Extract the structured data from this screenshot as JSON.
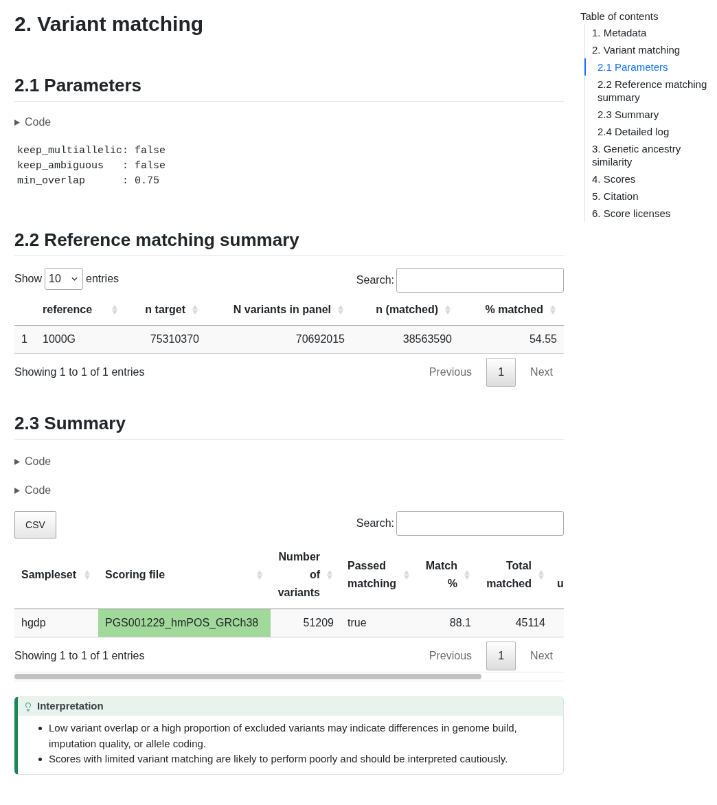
{
  "page": {
    "title": "2. Variant matching"
  },
  "parameters": {
    "heading": "2.1 Parameters",
    "code_toggle": {
      "label": "Code",
      "expanded": false
    },
    "output": [
      "keep_multiallelic: false",
      "keep_ambiguous   : false",
      "min_overlap      : 0.75"
    ]
  },
  "reference_matching": {
    "heading": "2.2 Reference matching summary",
    "length_menu": {
      "before": "Show",
      "value": "10",
      "after": "entries"
    },
    "search": {
      "label": "Search:"
    },
    "table": {
      "columns": [
        {
          "kind": "index",
          "sortable": false
        },
        {
          "label": "reference",
          "kind": "text",
          "sortable": true
        },
        {
          "label": "n target",
          "kind": "numeric",
          "sortable": true
        },
        {
          "label": "N variants in panel",
          "kind": "numeric",
          "sortable": true
        },
        {
          "label": "n (matched)",
          "kind": "numeric",
          "sortable": true
        },
        {
          "label": "% matched",
          "kind": "numeric",
          "sortable": true
        }
      ],
      "rows": [
        {
          "cells": [
            {
              "text": "1"
            },
            {
              "text": "1000G"
            },
            {
              "text": "75310370"
            },
            {
              "text": "70692015"
            },
            {
              "text": "38563590"
            },
            {
              "text": "54.55"
            }
          ]
        }
      ]
    },
    "info": "Showing 1 to 1 of 1 entries",
    "pagination": {
      "previous": {
        "label": "Previous",
        "disabled": true
      },
      "pages": [
        {
          "label": "1",
          "selected": true
        }
      ],
      "next": {
        "label": "Next",
        "disabled": true
      }
    }
  },
  "summary": {
    "heading": "2.3 Summary",
    "code_toggles": [
      {
        "label": "Code",
        "expanded": false
      },
      {
        "label": "Code",
        "expanded": false
      }
    ],
    "buttons": [
      {
        "label": "CSV"
      }
    ],
    "search": {
      "label": "Search:"
    },
    "table": {
      "columns": [
        {
          "label": "Sampleset",
          "kind": "text",
          "sortable": true
        },
        {
          "label": "Scoring file",
          "kind": "text",
          "sortable": true
        },
        {
          "label": "Number of variants",
          "kind": "numeric",
          "sortable": true
        },
        {
          "label": "Passed matching",
          "kind": "text",
          "sortable": true
        },
        {
          "label": "Match %",
          "kind": "numeric",
          "sortable": true
        },
        {
          "label": "Total matched",
          "kind": "numeric",
          "sortable": true
        },
        {
          "label": "u",
          "kind": "cut",
          "sortable": false
        }
      ],
      "rows": [
        {
          "cells": [
            {
              "text": "hgdp"
            },
            {
              "text": "PGS001229_hmPOS_GRCh38",
              "color": "#a1d99b"
            },
            {
              "text": "51209"
            },
            {
              "text": "true"
            },
            {
              "text": "88.1"
            },
            {
              "text": "45114"
            }
          ]
        }
      ]
    },
    "info": "Showing 1 to 1 of 1 entries",
    "pagination": {
      "previous": {
        "label": "Previous",
        "disabled": true
      },
      "pages": [
        {
          "label": "1",
          "selected": true
        }
      ],
      "next": {
        "label": "Next",
        "disabled": true
      }
    }
  },
  "callout": {
    "kind": "tip",
    "title": "Interpretation",
    "items": [
      "Low variant overlap or a high proportion of excluded variants may indicate differences in genome build, imputation quality, or allele coding.",
      "Scores with limited variant matching are likely to perform poorly and should be interpreted cautiously."
    ]
  },
  "toc": {
    "title": "Table of contents",
    "items": [
      {
        "label": "1. Metadata",
        "selected": false
      },
      {
        "label": "2. Variant matching",
        "selected": false,
        "children": [
          {
            "label": "2.1 Parameters",
            "selected": true
          },
          {
            "label": "2.2 Reference matching summary",
            "selected": false
          },
          {
            "label": "2.3 Summary",
            "selected": false
          },
          {
            "label": "2.4 Detailed log",
            "selected": false
          }
        ]
      },
      {
        "label": "3. Genetic ancestry similarity",
        "selected": false
      },
      {
        "label": "4. Scores",
        "selected": false
      },
      {
        "label": "5. Citation",
        "selected": false
      },
      {
        "label": "6. Score licenses",
        "selected": false
      }
    ]
  }
}
